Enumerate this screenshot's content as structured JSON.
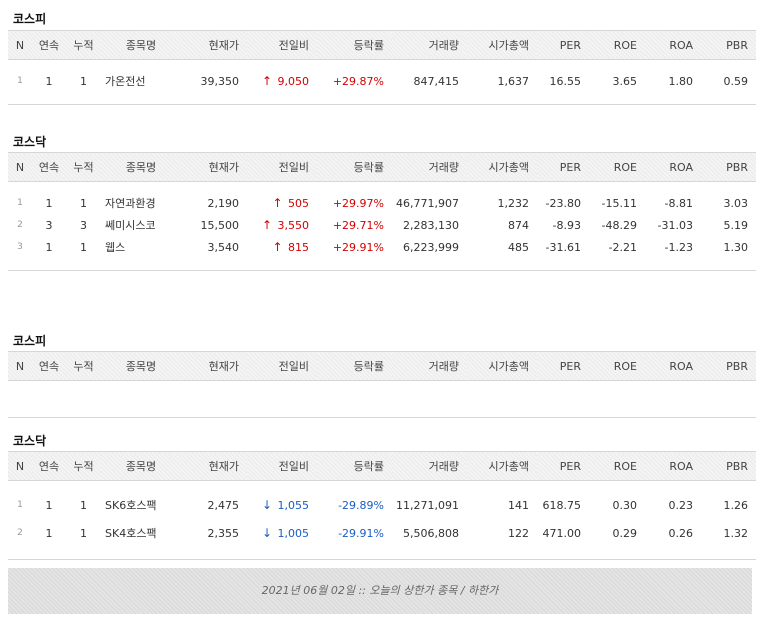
{
  "columns": [
    "N",
    "연속",
    "누적",
    "종목명",
    "현재가",
    "전일비",
    "등락률",
    "거래량",
    "시가총액",
    "PER",
    "ROE",
    "ROA",
    "PBR"
  ],
  "upper": {
    "kospi": {
      "title": "코스피",
      "rows": [
        {
          "n": "1",
          "streak": "1",
          "total": "1",
          "name": "가온전선",
          "price": "39,350",
          "change": "9,050",
          "rate": "+29.87%",
          "volume": "847,415",
          "mcap": "1,637",
          "per": "16.55",
          "roe": "3.65",
          "roa": "1.80",
          "pbr": "0.59"
        }
      ]
    },
    "kosdaq": {
      "title": "코스닥",
      "rows": [
        {
          "n": "1",
          "streak": "1",
          "total": "1",
          "name": "자연과환경",
          "price": "2,190",
          "change": "505",
          "rate": "+29.97%",
          "volume": "46,771,907",
          "mcap": "1,232",
          "per": "-23.80",
          "roe": "-15.11",
          "roa": "-8.81",
          "pbr": "3.03"
        },
        {
          "n": "2",
          "streak": "3",
          "total": "3",
          "name": "쎄미시스코",
          "price": "15,500",
          "change": "3,550",
          "rate": "+29.71%",
          "volume": "2,283,130",
          "mcap": "874",
          "per": "-8.93",
          "roe": "-48.29",
          "roa": "-31.03",
          "pbr": "5.19"
        },
        {
          "n": "3",
          "streak": "1",
          "total": "1",
          "name": "웹스",
          "price": "3,540",
          "change": "815",
          "rate": "+29.91%",
          "volume": "6,223,999",
          "mcap": "485",
          "per": "-31.61",
          "roe": "-2.21",
          "roa": "-1.23",
          "pbr": "1.30"
        }
      ]
    }
  },
  "lower": {
    "kospi": {
      "title": "코스피",
      "rows": []
    },
    "kosdaq": {
      "title": "코스닥",
      "rows": [
        {
          "n": "1",
          "streak": "1",
          "total": "1",
          "name": "SK6호스팩",
          "price": "2,475",
          "change": "1,055",
          "rate": "-29.89%",
          "volume": "11,271,091",
          "mcap": "141",
          "per": "618.75",
          "roe": "0.30",
          "roa": "0.23",
          "pbr": "1.26"
        },
        {
          "n": "2",
          "streak": "1",
          "total": "1",
          "name": "SK4호스팩",
          "price": "2,355",
          "change": "1,005",
          "rate": "-29.91%",
          "volume": "5,506,808",
          "mcap": "122",
          "per": "471.00",
          "roe": "0.29",
          "roa": "0.26",
          "pbr": "1.32"
        }
      ]
    }
  },
  "icons": {
    "up": "arrow-up-icon",
    "down": "arrow-down-icon"
  },
  "colors": {
    "up": "#d40000",
    "down": "#1a5cc8"
  },
  "footer": "2021년 06월 02일 :: 오늘의 상한가 종목 / 하한가"
}
